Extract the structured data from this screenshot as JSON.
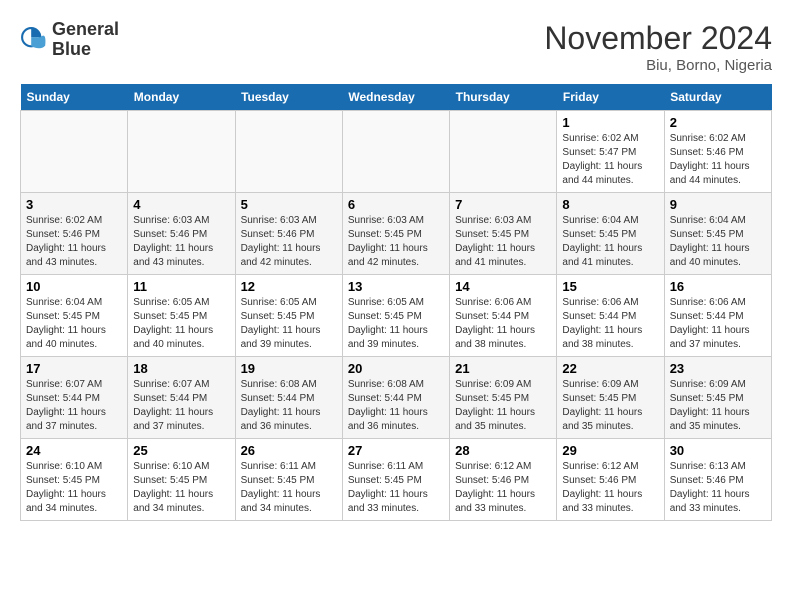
{
  "header": {
    "logo_line1": "General",
    "logo_line2": "Blue",
    "month_title": "November 2024",
    "location": "Biu, Borno, Nigeria"
  },
  "weekdays": [
    "Sunday",
    "Monday",
    "Tuesday",
    "Wednesday",
    "Thursday",
    "Friday",
    "Saturday"
  ],
  "weeks": [
    [
      {
        "day": "",
        "info": ""
      },
      {
        "day": "",
        "info": ""
      },
      {
        "day": "",
        "info": ""
      },
      {
        "day": "",
        "info": ""
      },
      {
        "day": "",
        "info": ""
      },
      {
        "day": "1",
        "info": "Sunrise: 6:02 AM\nSunset: 5:47 PM\nDaylight: 11 hours and 44 minutes."
      },
      {
        "day": "2",
        "info": "Sunrise: 6:02 AM\nSunset: 5:46 PM\nDaylight: 11 hours and 44 minutes."
      }
    ],
    [
      {
        "day": "3",
        "info": "Sunrise: 6:02 AM\nSunset: 5:46 PM\nDaylight: 11 hours and 43 minutes."
      },
      {
        "day": "4",
        "info": "Sunrise: 6:03 AM\nSunset: 5:46 PM\nDaylight: 11 hours and 43 minutes."
      },
      {
        "day": "5",
        "info": "Sunrise: 6:03 AM\nSunset: 5:46 PM\nDaylight: 11 hours and 42 minutes."
      },
      {
        "day": "6",
        "info": "Sunrise: 6:03 AM\nSunset: 5:45 PM\nDaylight: 11 hours and 42 minutes."
      },
      {
        "day": "7",
        "info": "Sunrise: 6:03 AM\nSunset: 5:45 PM\nDaylight: 11 hours and 41 minutes."
      },
      {
        "day": "8",
        "info": "Sunrise: 6:04 AM\nSunset: 5:45 PM\nDaylight: 11 hours and 41 minutes."
      },
      {
        "day": "9",
        "info": "Sunrise: 6:04 AM\nSunset: 5:45 PM\nDaylight: 11 hours and 40 minutes."
      }
    ],
    [
      {
        "day": "10",
        "info": "Sunrise: 6:04 AM\nSunset: 5:45 PM\nDaylight: 11 hours and 40 minutes."
      },
      {
        "day": "11",
        "info": "Sunrise: 6:05 AM\nSunset: 5:45 PM\nDaylight: 11 hours and 40 minutes."
      },
      {
        "day": "12",
        "info": "Sunrise: 6:05 AM\nSunset: 5:45 PM\nDaylight: 11 hours and 39 minutes."
      },
      {
        "day": "13",
        "info": "Sunrise: 6:05 AM\nSunset: 5:45 PM\nDaylight: 11 hours and 39 minutes."
      },
      {
        "day": "14",
        "info": "Sunrise: 6:06 AM\nSunset: 5:44 PM\nDaylight: 11 hours and 38 minutes."
      },
      {
        "day": "15",
        "info": "Sunrise: 6:06 AM\nSunset: 5:44 PM\nDaylight: 11 hours and 38 minutes."
      },
      {
        "day": "16",
        "info": "Sunrise: 6:06 AM\nSunset: 5:44 PM\nDaylight: 11 hours and 37 minutes."
      }
    ],
    [
      {
        "day": "17",
        "info": "Sunrise: 6:07 AM\nSunset: 5:44 PM\nDaylight: 11 hours and 37 minutes."
      },
      {
        "day": "18",
        "info": "Sunrise: 6:07 AM\nSunset: 5:44 PM\nDaylight: 11 hours and 37 minutes."
      },
      {
        "day": "19",
        "info": "Sunrise: 6:08 AM\nSunset: 5:44 PM\nDaylight: 11 hours and 36 minutes."
      },
      {
        "day": "20",
        "info": "Sunrise: 6:08 AM\nSunset: 5:44 PM\nDaylight: 11 hours and 36 minutes."
      },
      {
        "day": "21",
        "info": "Sunrise: 6:09 AM\nSunset: 5:45 PM\nDaylight: 11 hours and 35 minutes."
      },
      {
        "day": "22",
        "info": "Sunrise: 6:09 AM\nSunset: 5:45 PM\nDaylight: 11 hours and 35 minutes."
      },
      {
        "day": "23",
        "info": "Sunrise: 6:09 AM\nSunset: 5:45 PM\nDaylight: 11 hours and 35 minutes."
      }
    ],
    [
      {
        "day": "24",
        "info": "Sunrise: 6:10 AM\nSunset: 5:45 PM\nDaylight: 11 hours and 34 minutes."
      },
      {
        "day": "25",
        "info": "Sunrise: 6:10 AM\nSunset: 5:45 PM\nDaylight: 11 hours and 34 minutes."
      },
      {
        "day": "26",
        "info": "Sunrise: 6:11 AM\nSunset: 5:45 PM\nDaylight: 11 hours and 34 minutes."
      },
      {
        "day": "27",
        "info": "Sunrise: 6:11 AM\nSunset: 5:45 PM\nDaylight: 11 hours and 33 minutes."
      },
      {
        "day": "28",
        "info": "Sunrise: 6:12 AM\nSunset: 5:46 PM\nDaylight: 11 hours and 33 minutes."
      },
      {
        "day": "29",
        "info": "Sunrise: 6:12 AM\nSunset: 5:46 PM\nDaylight: 11 hours and 33 minutes."
      },
      {
        "day": "30",
        "info": "Sunrise: 6:13 AM\nSunset: 5:46 PM\nDaylight: 11 hours and 33 minutes."
      }
    ]
  ]
}
